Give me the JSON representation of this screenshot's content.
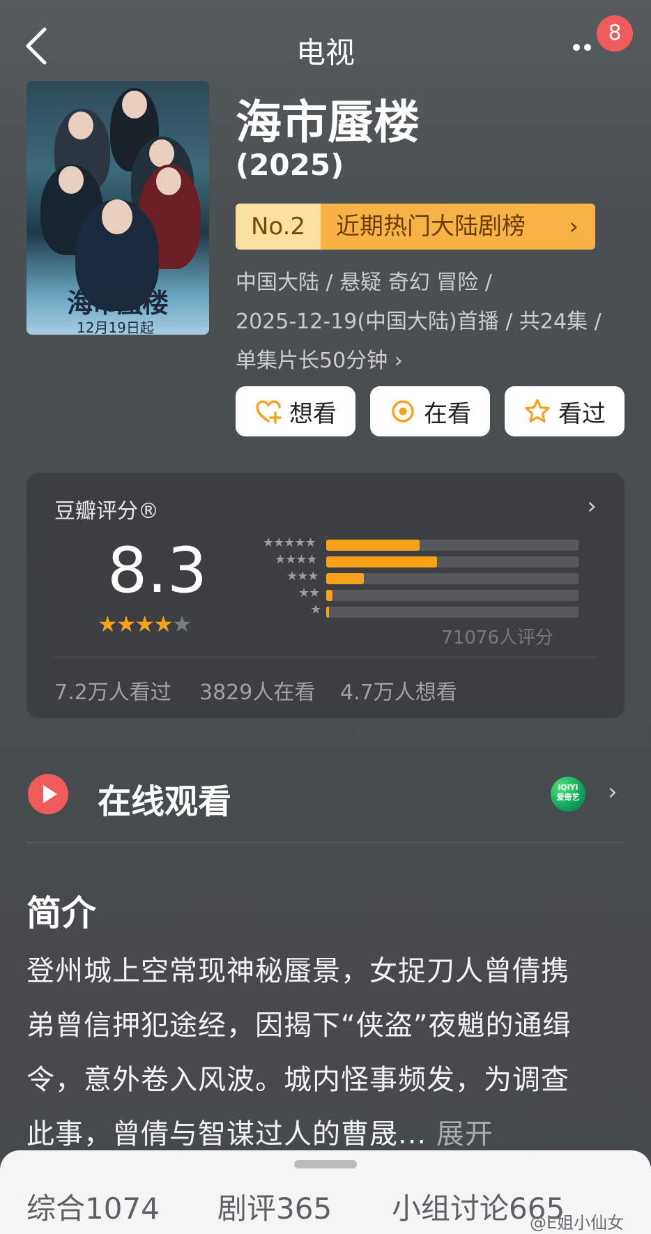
{
  "header": {
    "title": "电视",
    "notification_count": "8",
    "back_icon": "chevron-left-icon",
    "more_icon": "more-dots-icon"
  },
  "poster": {
    "title": "海市蜃楼",
    "date_text": "12月19日起"
  },
  "show": {
    "title": "海市蜃楼",
    "year": "(2025)",
    "rank_no": "No.2",
    "rank_label": "近期热门大陆剧榜",
    "rank_chevron": "›",
    "meta": [
      "中国大陆 / 悬疑 奇幻 冒险 /",
      "2025-12-19(中国大陆)首播 / 共24集 /",
      "单集片长50分钟 ›"
    ]
  },
  "actions": {
    "want": "想看",
    "watching": "在看",
    "watched": "看过"
  },
  "rating": {
    "label": "豆瓣评分®",
    "chevron": "›",
    "score": "8.3",
    "stars_full": 4,
    "stars_total": 5,
    "distribution": [
      {
        "stars": "★★★★★",
        "fraction": 0.37
      },
      {
        "stars": "★★★★",
        "fraction": 0.44
      },
      {
        "stars": "★★★",
        "fraction": 0.15
      },
      {
        "stars": "★★",
        "fraction": 0.025
      },
      {
        "stars": "★",
        "fraction": 0.01
      }
    ],
    "count": "71076人评分",
    "stats": [
      "7.2万人看过",
      "3829人在看",
      "4.7万人想看"
    ]
  },
  "online": {
    "label": "在线观看",
    "platform": "iQIYI 爱奇艺",
    "platform_line1": "iQIYI",
    "platform_line2": "爱奇艺",
    "chevron": "›"
  },
  "synopsis": {
    "heading": "简介",
    "lines": [
      "登州城上空常现神秘蜃景，女捉刀人曾倩携",
      "弟曾信押犯途经，因揭下“侠盗”夜魈的通缉",
      "令，意外卷入风波。城内怪事频发，为调查",
      "此事，曾倩与智谋过人的曹晟..."
    ],
    "expand": "展开"
  },
  "bottom_tabs": [
    {
      "label": "综合",
      "count": "1074"
    },
    {
      "label": "剧评",
      "count": "365"
    },
    {
      "label": "小组讨论",
      "count": "665"
    }
  ],
  "watermark": "@E姐小仙女"
}
